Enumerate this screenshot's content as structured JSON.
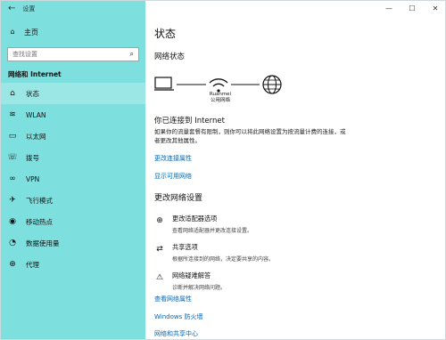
{
  "window": {
    "title": "设置",
    "controls": {
      "minimize": "—",
      "maximize": "☐",
      "close": "✕"
    }
  },
  "sidebar": {
    "home_label": "主页",
    "search_placeholder": "查找设置",
    "section_title": "网络和 Internet",
    "items": [
      {
        "label": "状态",
        "icon": "home-globe-icon"
      },
      {
        "label": "WLAN",
        "icon": "wifi-icon"
      },
      {
        "label": "以太网",
        "icon": "ethernet-icon"
      },
      {
        "label": "拨号",
        "icon": "phone-icon"
      },
      {
        "label": "VPN",
        "icon": "vpn-icon"
      },
      {
        "label": "飞行模式",
        "icon": "airplane-icon"
      },
      {
        "label": "移动热点",
        "icon": "hotspot-icon"
      },
      {
        "label": "数据使用量",
        "icon": "data-usage-icon"
      },
      {
        "label": "代理",
        "icon": "globe-icon"
      }
    ]
  },
  "main": {
    "title": "状态",
    "network_status_label": "网络状态",
    "network_name": "Ruanmei",
    "network_type": "公用网络",
    "connected_heading": "你已连接到 Internet",
    "connected_desc": "如果你的流量套餐有限制，则你可以将此网络设置为按流量计费的连接，或者更改其他属性。",
    "links_top": [
      "更改连接属性",
      "显示可用网络"
    ],
    "change_settings_heading": "更改网络设置",
    "options": [
      {
        "title": "更改适配器选项",
        "desc": "查看网络适配器并更改连接设置。",
        "icon": "adapter-icon"
      },
      {
        "title": "共享选项",
        "desc": "根据所连接到的网络，决定要共享的内容。",
        "icon": "share-icon"
      },
      {
        "title": "网络疑难解答",
        "desc": "诊断并解决网络问题。",
        "icon": "warning-icon"
      }
    ],
    "links_bottom": [
      "查看网络属性",
      "Windows 防火墙",
      "网络和共享中心"
    ]
  },
  "colors": {
    "sidebar_bg": "#7ee0de",
    "link": "#0067b8"
  }
}
